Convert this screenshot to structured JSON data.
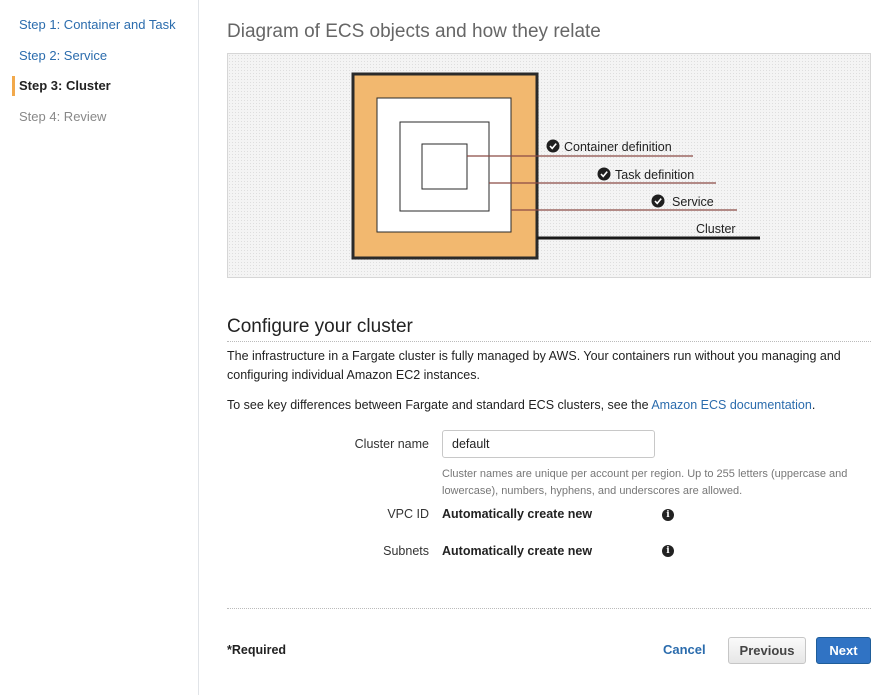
{
  "sidebar": {
    "steps": [
      {
        "label": "Step 1: Container and Task",
        "state": "link"
      },
      {
        "label": "Step 2: Service",
        "state": "link"
      },
      {
        "label": "Step 3: Cluster",
        "state": "active"
      },
      {
        "label": "Step 4: Review",
        "state": "disabled"
      }
    ]
  },
  "diagram": {
    "title": "Diagram of ECS objects and how they relate",
    "labels": {
      "container": "Container definition",
      "task": "Task definition",
      "service": "Service",
      "cluster": "Cluster"
    },
    "check_icon": "check-circle-icon"
  },
  "configure": {
    "title": "Configure your cluster",
    "paragraph1": "The infrastructure in a Fargate cluster is fully managed by AWS. Your containers run without you managing and configuring individual Amazon EC2 instances.",
    "paragraph2_prefix": "To see key differences between Fargate and standard ECS clusters, see the ",
    "paragraph2_link": "Amazon ECS documentation",
    "paragraph2_suffix": ".",
    "cluster_name_label": "Cluster name",
    "cluster_name_value": "default",
    "cluster_name_hint": "Cluster names are unique per account per region. Up to 255 letters (uppercase and lowercase), numbers, hyphens, and underscores are allowed.",
    "vpc_label": "VPC ID",
    "vpc_value": "Automatically create new",
    "subnets_label": "Subnets",
    "subnets_value": "Automatically create new",
    "info_icon": "info-circle-icon"
  },
  "footer": {
    "required": "*Required",
    "cancel": "Cancel",
    "previous": "Previous",
    "next": "Next"
  },
  "colors": {
    "accent_orange": "#f2b86f",
    "link_blue": "#2b6cad",
    "primary_button": "#3073c4",
    "connector_line": "#8b4a45"
  }
}
